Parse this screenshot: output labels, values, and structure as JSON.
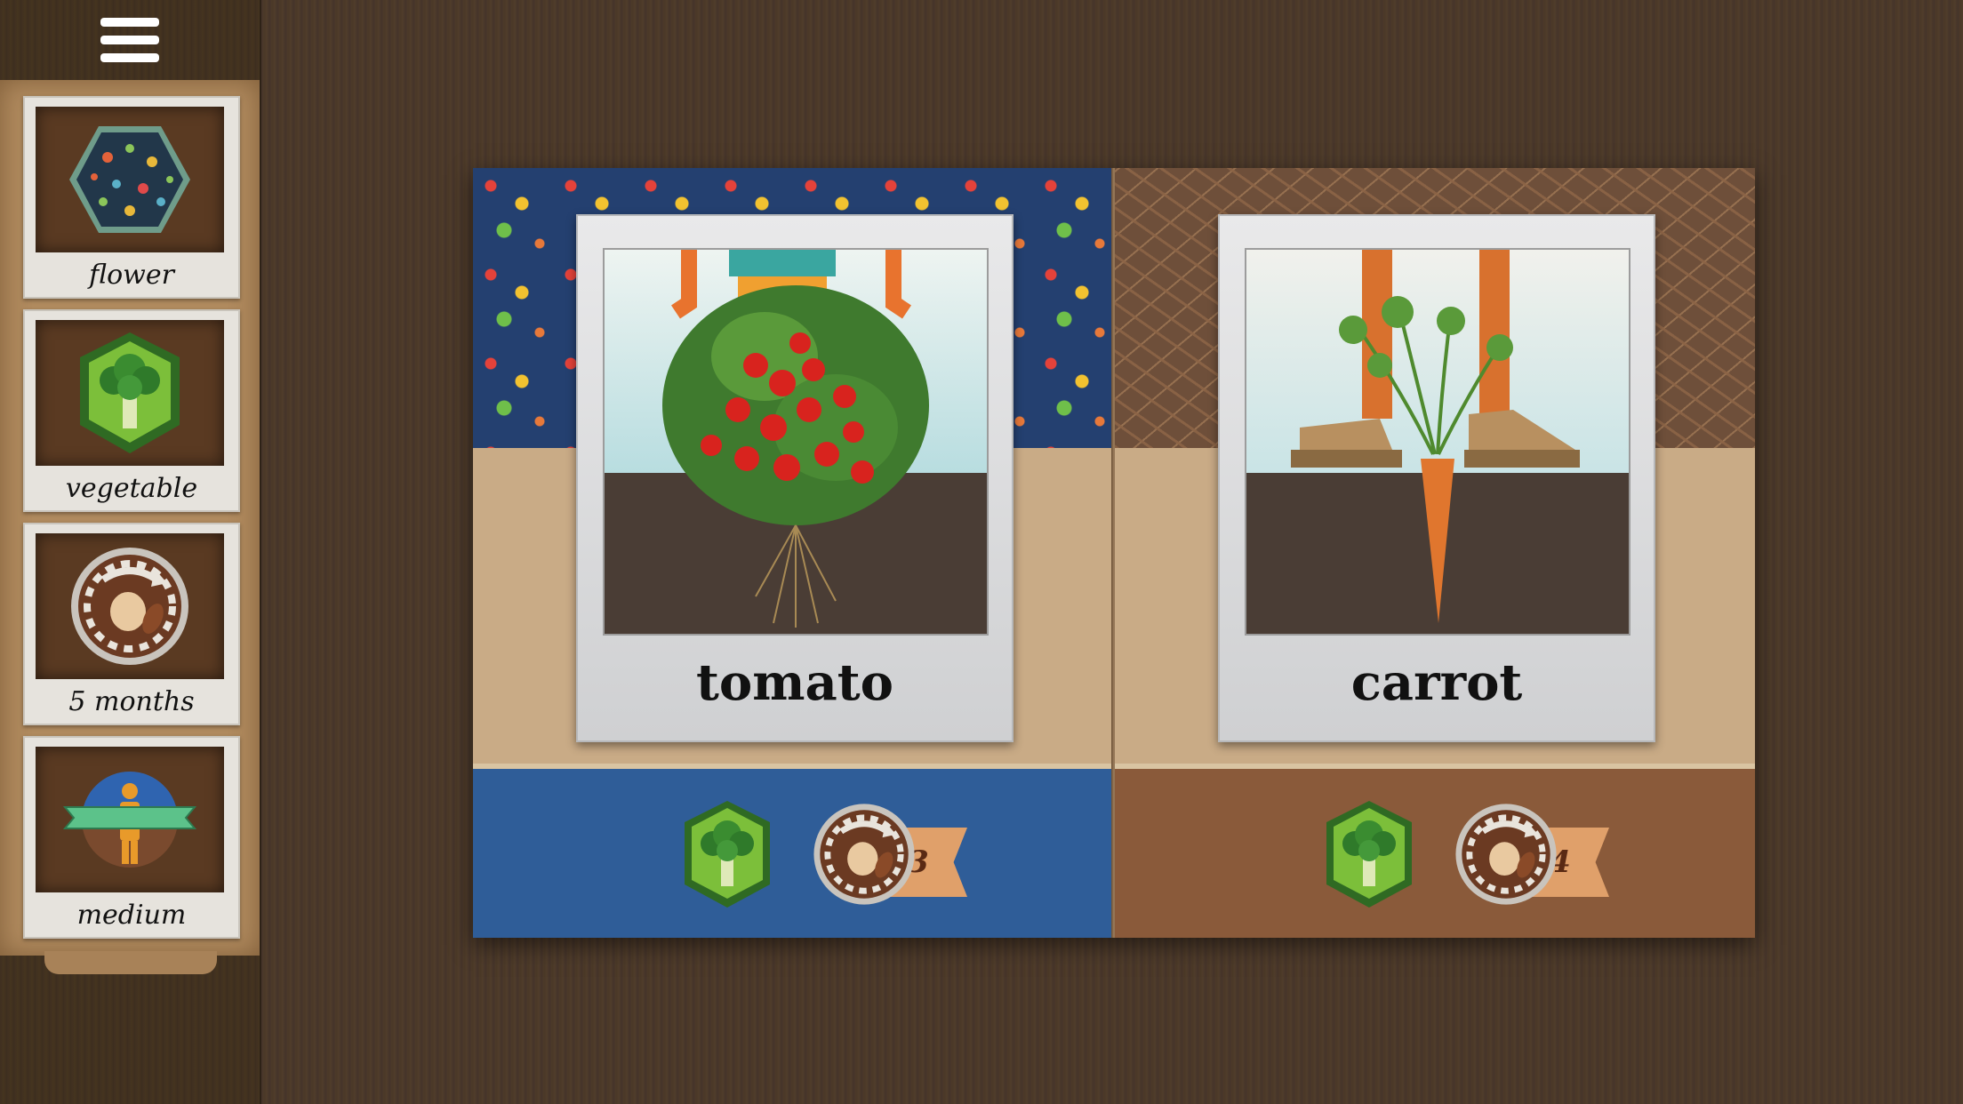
{
  "sidebar": {
    "tiles": [
      {
        "label": "flower",
        "icon": "patterned-hexagon-icon"
      },
      {
        "label": "vegetable",
        "icon": "broccoli-icon"
      },
      {
        "label": "5 months",
        "icon": "seed-cycle-icon"
      },
      {
        "label": "medium",
        "icon": "person-size-icon"
      }
    ]
  },
  "cards": [
    {
      "title": "tomato",
      "count": "3",
      "category_icon": "broccoli-icon",
      "cycle_icon": "seed-cycle-icon"
    },
    {
      "title": "carrot",
      "count": "4",
      "category_icon": "broccoli-icon",
      "cycle_icon": "seed-cycle-icon"
    }
  ],
  "colors": {
    "accent_green": "#3f8b2e",
    "page_blue": "#2f5d98",
    "page_brown": "#8a5a3a",
    "tag_orange": "#e0a06a"
  }
}
